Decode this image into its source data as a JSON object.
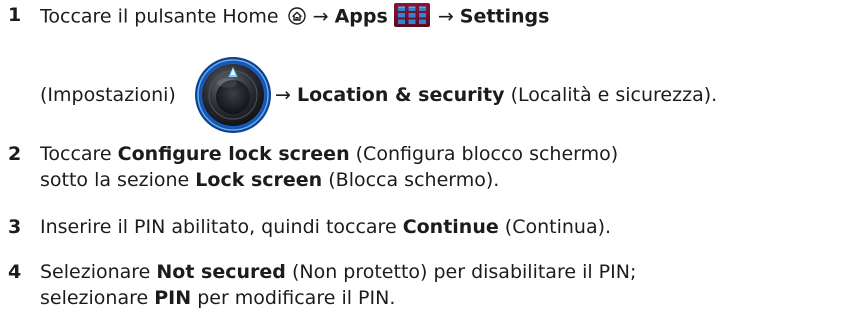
{
  "steps": [
    {
      "number": "1",
      "line1": {
        "a": "Toccare il pulsante Home ",
        "arrow1": " → ",
        "apps": "Apps",
        "arrow2": " → ",
        "settings": "Settings"
      },
      "line2": {
        "a": "(Impostazioni)",
        "arrow": "→ ",
        "location": "Location & security",
        "b": " (Località e sicurezza)."
      }
    },
    {
      "number": "2",
      "line1": {
        "a": "Toccare ",
        "bold": "Configure lock screen",
        "b": " (Configura blocco schermo)"
      },
      "line2": {
        "a": "sotto la sezione ",
        "bold": "Lock screen",
        "b": " (Blocca schermo)."
      }
    },
    {
      "number": "3",
      "line1": {
        "a": "Inserire il PIN abilitato, quindi toccare ",
        "bold": "Continue",
        "b": " (Continua)."
      }
    },
    {
      "number": "4",
      "line1": {
        "a": "Selezionare ",
        "bold": "Not secured",
        "b": " (Non protetto) per disabilitare il PIN;"
      },
      "line2": {
        "a": "selezionare ",
        "bold": "PIN",
        "b": " per modificare il PIN."
      }
    }
  ],
  "icons": {
    "home": "home-button-icon",
    "apps": "apps-grid-icon",
    "settings": "settings-knob-icon"
  }
}
